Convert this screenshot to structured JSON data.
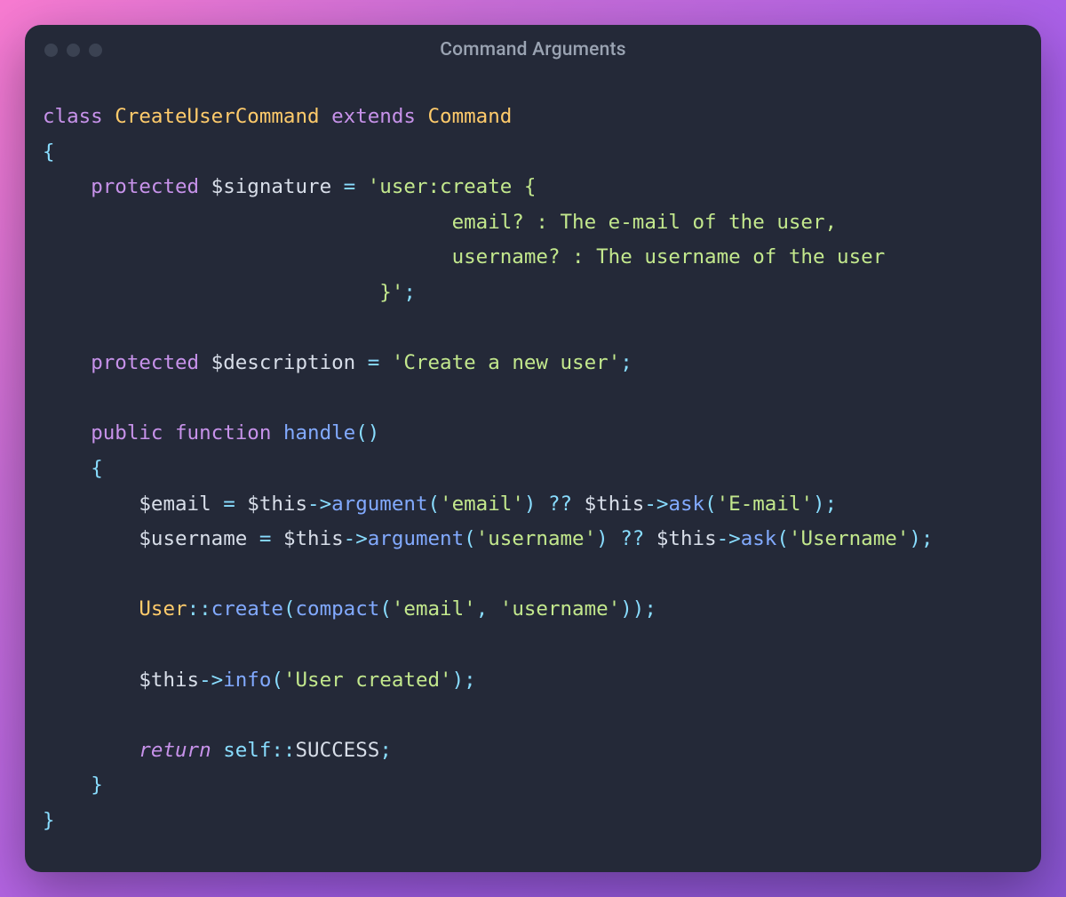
{
  "window": {
    "title": "Command Arguments"
  },
  "code": {
    "kw_class": "class",
    "cls_main": "CreateUserCommand",
    "kw_extends": "extends",
    "cls_parent": "Command",
    "brace_open": "{",
    "brace_close": "}",
    "kw_protected1": "protected",
    "var_signature": "$signature",
    "op_eq": "=",
    "str_sig1": "'user:create {",
    "str_sig2": "email? : The e-mail of the user,",
    "str_sig3": "username? : The username of the user",
    "str_sig4": "}'",
    "semi": ";",
    "kw_protected2": "protected",
    "var_description": "$description",
    "str_desc": "'Create a new user'",
    "kw_public": "public",
    "kw_function": "function",
    "fn_handle": "handle",
    "paren_open": "(",
    "paren_close": ")",
    "var_email": "$email",
    "var_this": "$this",
    "arrow": "->",
    "fn_argument": "argument",
    "str_email_arg": "'email'",
    "op_nullish": "??",
    "fn_ask": "ask",
    "str_email_prompt": "'E-mail'",
    "var_username": "$username",
    "str_username_arg": "'username'",
    "str_username_prompt": "'Username'",
    "cls_user": "User",
    "dcolon": "::",
    "fn_create": "create",
    "fn_compact": "compact",
    "str_email_lit": "'email'",
    "comma_sp": ", ",
    "str_username_lit": "'username'",
    "fn_info": "info",
    "str_info": "'User created'",
    "kw_return": "return",
    "kw_self": "self",
    "const_success": "SUCCESS"
  }
}
